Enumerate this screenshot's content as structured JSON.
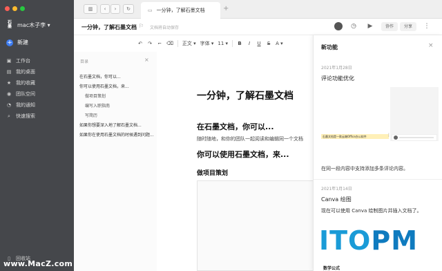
{
  "sidebar": {
    "user_name": "mac木子李 ▾",
    "logo_text": "石墨",
    "new_label": "新建",
    "items": [
      {
        "icon": "desk-icon",
        "glyph": "▣",
        "label": "工作台"
      },
      {
        "icon": "desktop-icon",
        "glyph": "▤",
        "label": "我的桌面"
      },
      {
        "icon": "star-icon",
        "glyph": "★",
        "label": "我的收藏"
      },
      {
        "icon": "team-icon",
        "glyph": "◉",
        "label": "团队空间"
      },
      {
        "icon": "bell-icon",
        "glyph": "◔",
        "label": "我的通知"
      },
      {
        "icon": "search-icon",
        "glyph": "⌕",
        "label": "快速搜索"
      }
    ],
    "trash_label": "回收站",
    "watermark": "www.MacZ.com"
  },
  "tabbar": {
    "tab_title": "一分钟，了解石墨文档",
    "back_glyph": "‹",
    "forward_glyph": "›",
    "refresh_glyph": "↻",
    "sidebar_toggle_glyph": "▥",
    "close_glyph": "×",
    "new_tab_glyph": "+"
  },
  "header": {
    "title": "一分钟，了解石墨文档",
    "autosave": "文档将自动保存",
    "collab_label": "协作",
    "share_label": "分享",
    "history_glyph": "◷",
    "present_glyph": "▶",
    "more_glyph": "⋮"
  },
  "toolbar": {
    "undo": "↶",
    "redo": "↷",
    "format_painter": "⌐",
    "clear": "⌫",
    "style": "正文 ▾",
    "font": "字体 ▾",
    "size": "11 ▾",
    "bold": "B",
    "italic": "I",
    "underline": "U",
    "strike": "S",
    "color": "A ▾"
  },
  "outline": {
    "header": "目录",
    "items": [
      {
        "label": "在石墨文档，你可以...",
        "level": 1
      },
      {
        "label": "你可以使用石墨文档，来...",
        "level": 1
      },
      {
        "label": "做项目策划",
        "level": 2
      },
      {
        "label": "编写入职指南",
        "level": 2
      },
      {
        "label": "写简历",
        "level": 2
      },
      {
        "label": "如果你想要深入地了解石墨文档...",
        "level": 1
      },
      {
        "label": "如果你在使用石墨文档的时候遇到问题...",
        "level": 1
      }
    ]
  },
  "document": {
    "title": "一分钟，了解石墨文档",
    "h2_1": "在石墨文档，你可以...",
    "paragraph": "随时随地，和你的团队一起阅读和编辑同一个文档",
    "h2_2": "你可以使用石墨文档，来...",
    "h3_1": "做项目策划"
  },
  "panel": {
    "title": "新功能",
    "close_glyph": "×",
    "features": [
      {
        "date": "2021年1月28日",
        "title": "评论功能优化",
        "desc": "在同一段内容中支持添加多条评论内容。"
      },
      {
        "date": "2021年1月14日",
        "title": "Canva 绘图",
        "desc": "现在可以使用 Canva 绘制图片并插入文档了。"
      }
    ],
    "preview_highlight": "石墨文档是一款云端Office办公软件",
    "preview_more": "⋮",
    "watermark_it": "ITO",
    "watermark_pm": "PM",
    "third_feature": "数学公式"
  },
  "colors": {
    "sidebar_bg": "#45474b",
    "accent": "#3d7cf0",
    "itopm": "#1a9bd7"
  }
}
